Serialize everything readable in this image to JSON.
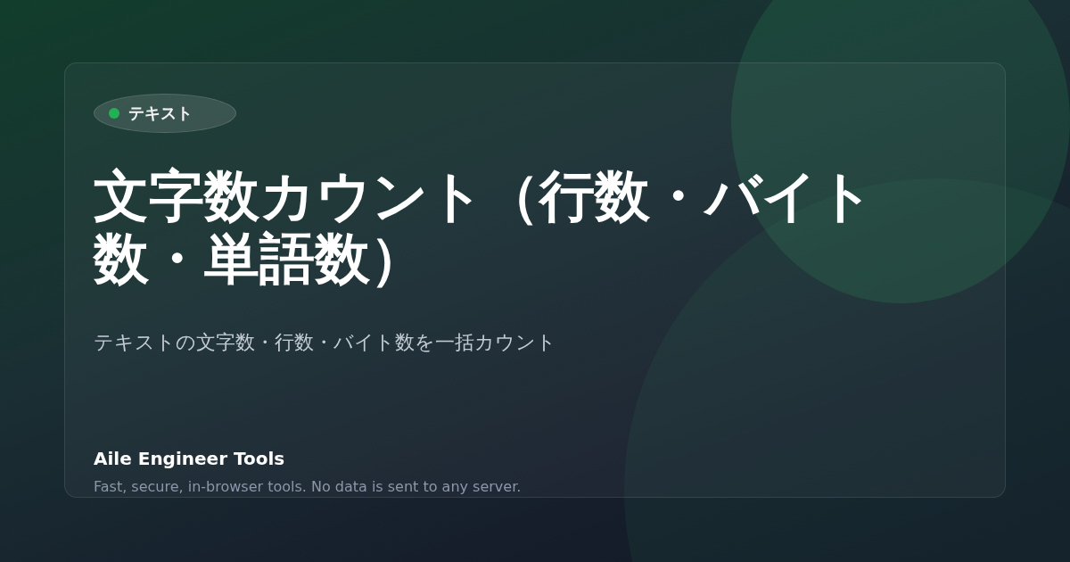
{
  "badge": {
    "label": "テキスト"
  },
  "title": "文字数カウント（行数・バイト数・単語数）",
  "subtitle": "テキストの文字数・行数・バイト数を一括カウント",
  "footer": {
    "brand": "Aile Engineer Tools",
    "tagline": "Fast, secure, in-browser tools. No data is sent to any server."
  }
}
